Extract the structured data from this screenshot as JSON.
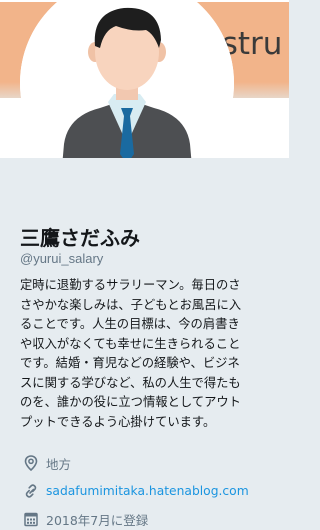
{
  "banner": {
    "text": "rastru",
    "colors": {
      "band": "#f2b48a",
      "text": "#3a3a3a"
    }
  },
  "profile": {
    "display_name": "三鷹さだふみ",
    "handle": "@yurui_salary",
    "bio_lines": [
      "定時に退勤するサラリーマン。毎日のさ",
      "さやかな楽しみは、子どもとお風呂に入",
      "ることです。人生の目標は、今の肩書き",
      "や収入がなくても幸せに生きられること",
      "です。結婚・育児などの経験や、ビジネ",
      "スに関する学びなど、私の人生で得たも",
      "のを、誰かの役に立つ情報としてアウト",
      "プットできるよう心掛けています。"
    ],
    "location": "地方",
    "website": "sadafumimitaka.hatenablog.com",
    "joined": "2018年7月に登録"
  },
  "icons": {
    "location": "location-pin-icon",
    "website": "link-icon",
    "joined": "calendar-icon"
  },
  "colors": {
    "background": "#e6ecf0",
    "link": "#1b95e0",
    "secondary_text": "#657786",
    "primary_text": "#14171a"
  }
}
